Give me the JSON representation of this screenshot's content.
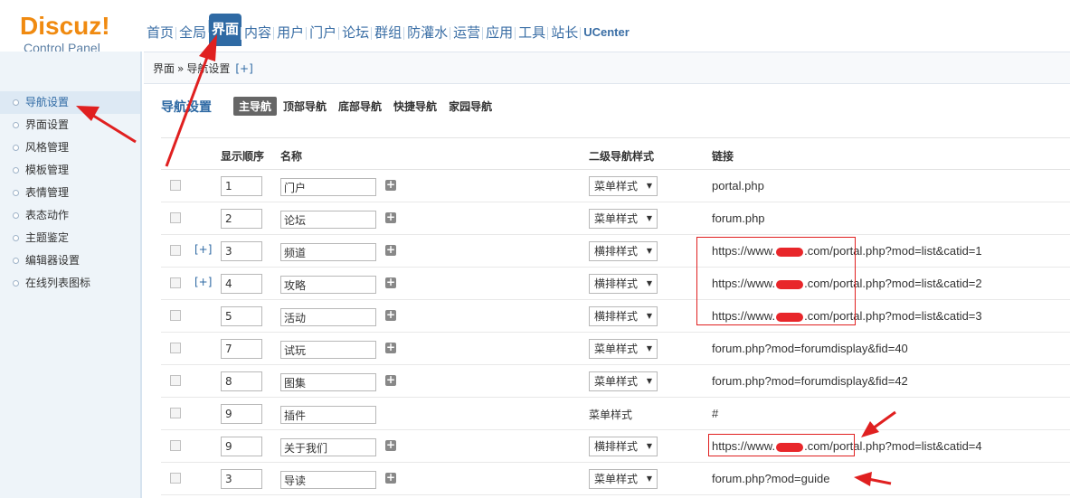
{
  "logo": {
    "main": "Discuz!",
    "sub": "Control Panel"
  },
  "topnav": [
    "首页",
    "全局",
    "界面",
    "内容",
    "用户",
    "门户",
    "论坛",
    "群组",
    "防灌水",
    "运营",
    "应用",
    "工具",
    "站长",
    "UCenter"
  ],
  "topnav_active": "界面",
  "sidebar": [
    "导航设置",
    "界面设置",
    "风格管理",
    "模板管理",
    "表情管理",
    "表态动作",
    "主题鉴定",
    "编辑器设置",
    "在线列表图标"
  ],
  "breadcrumb": {
    "parts": [
      "界面",
      "导航设置"
    ],
    "sep": "»",
    "plus": "[+]"
  },
  "page_title": "导航设置",
  "subtabs": [
    "主导航",
    "顶部导航",
    "底部导航",
    "快捷导航",
    "家园导航"
  ],
  "table": {
    "headers": {
      "order": "显示顺序",
      "name": "名称",
      "style": "二级导航样式",
      "link": "链接"
    },
    "rows": [
      {
        "expand": "",
        "order": "1",
        "name": "门户",
        "style": "菜单样式",
        "select": true,
        "link_pre": "portal.php",
        "link_post": "",
        "redacted": false,
        "add": true
      },
      {
        "expand": "",
        "order": "2",
        "name": "论坛",
        "style": "菜单样式",
        "select": true,
        "link_pre": "forum.php",
        "link_post": "",
        "redacted": false,
        "add": true
      },
      {
        "expand": "[+]",
        "order": "3",
        "name": "频道",
        "style": "横排样式",
        "select": true,
        "link_pre": "https://www.",
        "link_post": ".com/portal.php?mod=list&catid=1",
        "redacted": true,
        "add": true
      },
      {
        "expand": "[+]",
        "order": "4",
        "name": "攻略",
        "style": "横排样式",
        "select": true,
        "link_pre": "https://www.",
        "link_post": ".com/portal.php?mod=list&catid=2",
        "redacted": true,
        "add": true
      },
      {
        "expand": "",
        "order": "5",
        "name": "活动",
        "style": "横排样式",
        "select": true,
        "link_pre": "https://www.",
        "link_post": ".com/portal.php?mod=list&catid=3",
        "redacted": true,
        "add": true
      },
      {
        "expand": "",
        "order": "7",
        "name": "试玩",
        "style": "菜单样式",
        "select": true,
        "link_pre": "forum.php?mod=forumdisplay&fid=40",
        "link_post": "",
        "redacted": false,
        "add": true
      },
      {
        "expand": "",
        "order": "8",
        "name": "图集",
        "style": "菜单样式",
        "select": true,
        "link_pre": "forum.php?mod=forumdisplay&fid=42",
        "link_post": "",
        "redacted": false,
        "add": true
      },
      {
        "expand": "",
        "order": "9",
        "name": "插件",
        "style": "菜单样式",
        "select": false,
        "link_pre": "#",
        "link_post": "",
        "redacted": false,
        "add": false
      },
      {
        "expand": "",
        "order": "9",
        "name": "关于我们",
        "style": "横排样式",
        "select": true,
        "link_pre": "https://www.",
        "link_post": ".com/portal.php?mod=list&catid=4",
        "redacted": true,
        "add": true
      },
      {
        "expand": "",
        "order": "3",
        "name": "导读",
        "style": "菜单样式",
        "select": true,
        "link_pre": "forum.php?mod=guide",
        "link_post": "",
        "redacted": false,
        "add": true
      }
    ]
  },
  "colors": {
    "accent": "#2f6aa4",
    "logo": "#f08a10",
    "annotation": "#e02020"
  },
  "icons": {
    "add": "plus-square-icon",
    "dropdown": "triangle-down-icon"
  }
}
